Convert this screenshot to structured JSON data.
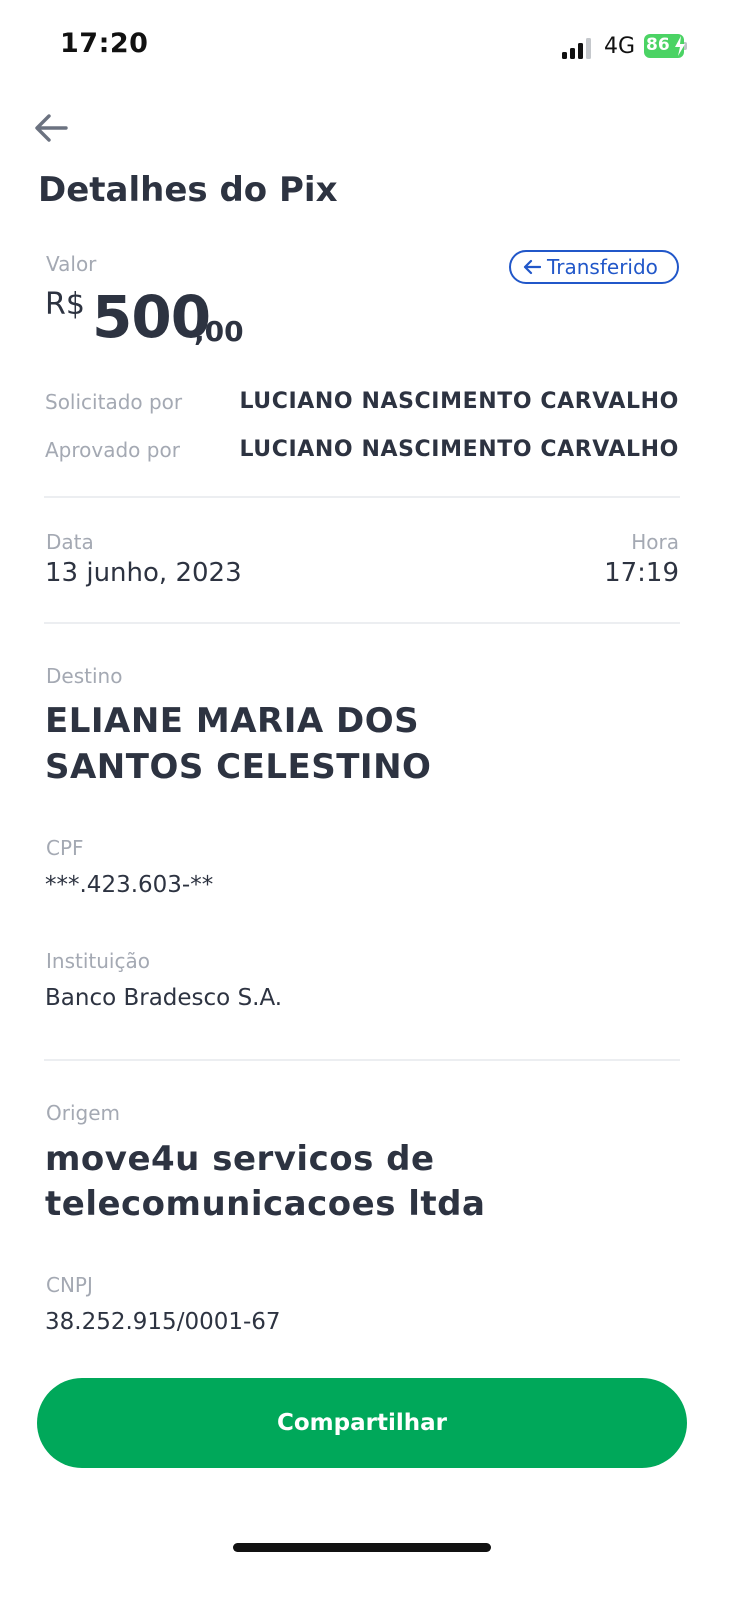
{
  "status_bar": {
    "time": "17:20",
    "network": "4G",
    "battery": "86",
    "battery_color": "#4bd364"
  },
  "header": {
    "back_icon": "arrow-left-icon",
    "title": "Detalhes do Pix"
  },
  "amount": {
    "label": "Valor",
    "currency": "R$",
    "integer": "500",
    "decimal": ",00",
    "status_badge": "Transferido",
    "badge_color": "#2157c9"
  },
  "people": {
    "requested_label": "Solicitado por",
    "requested_value": "LUCIANO NASCIMENTO CARVALHO",
    "approved_label": "Aprovado por",
    "approved_value": "LUCIANO NASCIMENTO CARVALHO"
  },
  "datetime": {
    "date_label": "Data",
    "date_value": "13 junho, 2023",
    "time_label": "Hora",
    "time_value": "17:19"
  },
  "destination": {
    "label": "Destino",
    "name_line1": "ELIANE MARIA DOS",
    "name_line2": "SANTOS CELESTINO",
    "cpf_label": "CPF",
    "cpf_value": "***.423.603-**",
    "institution_label": "Instituição",
    "institution_value": "Banco Bradesco S.A."
  },
  "origin": {
    "label": "Origem",
    "name_line1": "move4u servicos de",
    "name_line2": "telecomunicacoes ltda",
    "cnpj_label": "CNPJ",
    "cnpj_value": "38.252.915/0001-67"
  },
  "actions": {
    "share_label": "Compartilhar",
    "share_color": "#00a85a"
  }
}
